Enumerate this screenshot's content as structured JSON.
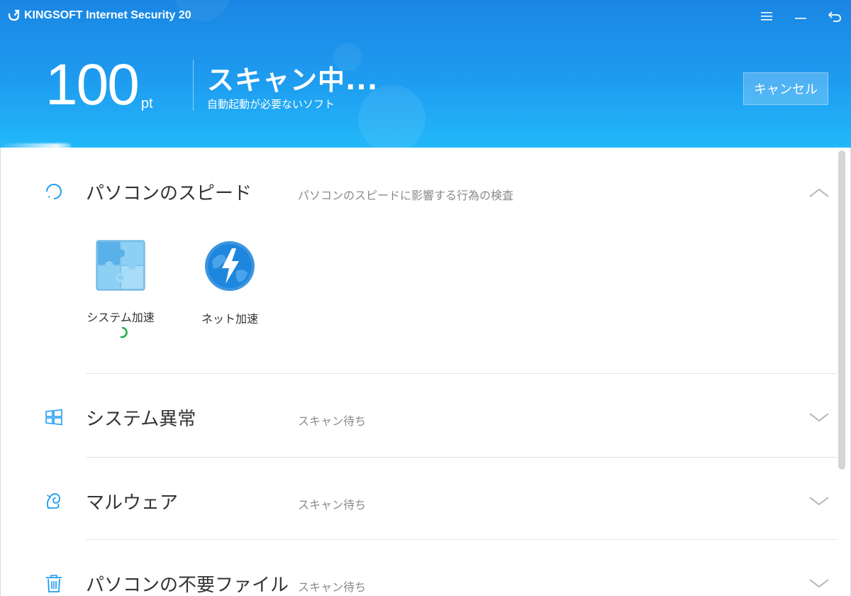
{
  "app": {
    "title": "KINGSOFT Internet Security 20"
  },
  "window_controls": [
    {
      "icon": "menu-icon"
    },
    {
      "icon": "minimize-icon"
    },
    {
      "icon": "back-icon"
    }
  ],
  "header": {
    "score": "100",
    "score_unit": "pt",
    "status_title": "スキャン中...",
    "status_subtitle": "自動起動が必要ないソフト",
    "cancel_label": "キャンセル"
  },
  "sections": [
    {
      "icon": "spinner-icon",
      "title": "パソコンのスピード",
      "description": "パソコンのスピードに影響する行為の検査",
      "expanded": true,
      "items": [
        {
          "icon": "puzzle-icon",
          "label": "システム加速",
          "scanning": true
        },
        {
          "icon": "globe-lightning-icon",
          "label": "ネット加速",
          "scanning": false
        }
      ]
    },
    {
      "icon": "windows-icon",
      "title": "システム異常",
      "description": "スキャン待ち",
      "expanded": false
    },
    {
      "icon": "malware-icon",
      "title": "マルウェア",
      "description": "スキャン待ち",
      "expanded": false
    },
    {
      "icon": "trash-icon",
      "title": "パソコンの不要ファイル",
      "description": "スキャン待ち",
      "expanded": false
    }
  ],
  "colors": {
    "header_top": "#1a86e3",
    "header_bottom": "#22b8f9",
    "accent": "#1e9cf0",
    "spinner_green": "#22b14c"
  }
}
